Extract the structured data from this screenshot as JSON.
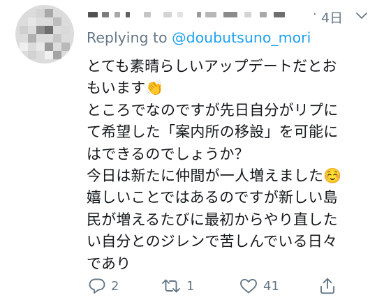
{
  "tweet": {
    "time": "4日",
    "separator": "·",
    "reply_prefix": "Replying to ",
    "reply_handle": "@doubutsuno_mori",
    "lines": [
      "とても素晴らしいアップデートだとお",
      "もいます👏",
      "ところでなのですが先日自分がリプに",
      "て希望した「案内所の移設」を可能に",
      "はできるのでしょうか？",
      "今日は新たに仲間が一人増えました☺️",
      "嬉しいことではあるのですが新しい島",
      "民が増えるたびに最初からやり直した",
      "い自分とのジレンで苦しんでいる日々",
      "であり"
    ]
  },
  "actions": {
    "reply_count": "2",
    "retweet_count": "1",
    "like_count": "41"
  },
  "icons": {
    "menu": "chevron-down-icon",
    "reply": "speech-bubble-icon",
    "retweet": "retweet-icon",
    "like": "heart-icon",
    "share": "share-icon"
  },
  "colors": {
    "text": "#14171a",
    "secondary": "#657786",
    "link": "#1da1f2"
  }
}
